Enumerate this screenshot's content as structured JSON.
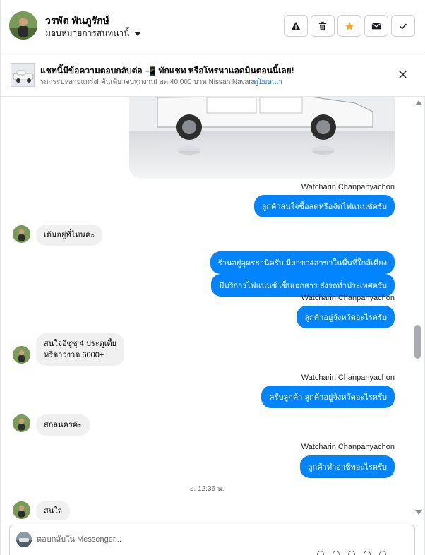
{
  "header": {
    "contact_name": "วรพัต พันภูรักษ์",
    "assign_label": "มอบหมายการสนทนานี้",
    "action_icons": [
      "warning-icon",
      "trash-icon",
      "star-icon",
      "mail-icon",
      "check-icon"
    ]
  },
  "ad": {
    "title": "แชทนี้มีข้อความตอบกลับต่อ",
    "title_emoji": "📲",
    "title_rest": "ทักแชท หรือโทรหาแอดมินตอนนี้เลย!",
    "subtitle": "รถกระบะสายแกร่ง! คันเดียวจบทุกงาน! ลด 40,000 บาท Nissan Navara ...",
    "link": "ดูโฆษณา"
  },
  "messages": [
    {
      "type": "out",
      "sender": "Watcharin Chanpanyachon",
      "text": "ลูกค้าสนใจซื้อสดหรือจัดไฟแนนซ์ครับ"
    },
    {
      "type": "in",
      "text": "เต้นอยู่ที่ไหนค่ะ"
    },
    {
      "type": "out",
      "text": "ร้านอยู่อุดรธานีครับ มีสาขา4สาขาในพื้นที่ใกล้เคียง"
    },
    {
      "type": "out",
      "text": "มีบริการไฟแนนซ์ เซ็นเอกสาร ส่งรถทั่วประเทศครับ"
    },
    {
      "type": "out",
      "sender": "Watcharin Chanpanyachon",
      "text": "ลูกค้าอยู่จังหวัดอะไรครับ"
    },
    {
      "type": "in",
      "lines": [
        "สนใจอีซูซุ 4 ประตูเตี้ย",
        "หรีดาวงวด 6000+"
      ]
    },
    {
      "type": "out",
      "sender": "Watcharin Chanpanyachon",
      "text": "ครับลูกค้า ลูกค้าอยู่จังหวัดอะไรครับ"
    },
    {
      "type": "in",
      "text": "สกลนครค่ะ"
    },
    {
      "type": "out",
      "sender": "Watcharin Chanpanyachon",
      "text": "ลูกค้าทำอาชีพอะไรครับ"
    },
    {
      "type": "in",
      "text": "สนใจ"
    }
  ],
  "timestamp": "อ. 12:36 น.",
  "composer": {
    "placeholder": "ตอบกลับใน Messenger..."
  },
  "colors": {
    "outgoing_bubble": "#0084ff",
    "incoming_bubble": "#f0f0f0",
    "star": "#f5a623",
    "link": "#1877f2"
  }
}
